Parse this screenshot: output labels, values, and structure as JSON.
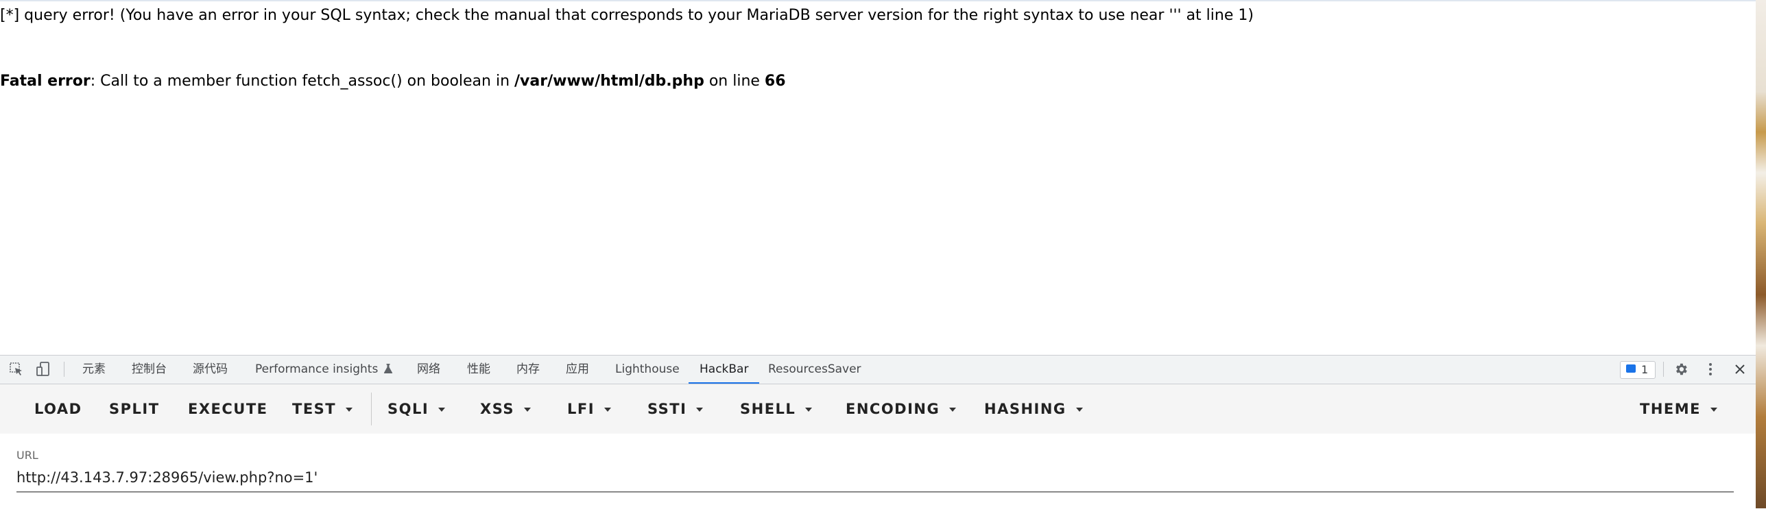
{
  "page": {
    "query_error": "[*] query error! (You have an error in your SQL syntax; check the manual that corresponds to your MariaDB server version for the right syntax to use near ''' at line 1)",
    "fatal_label": "Fatal error",
    "fatal_mid": ": Call to a member function fetch_assoc() on boolean in ",
    "fatal_path": "/var/www/html/db.php",
    "fatal_online": " on line ",
    "fatal_line": "66"
  },
  "devtools": {
    "tabs": [
      "元素",
      "控制台",
      "源代码",
      "Performance insights",
      "网络",
      "性能",
      "内存",
      "应用",
      "Lighthouse",
      "HackBar",
      "ResourcesSaver"
    ],
    "active_tab": "HackBar",
    "issues_count": "1",
    "icons": [
      "inspect-element-icon",
      "device-toolbar-icon",
      "flask-icon",
      "issues-icon",
      "gear-icon",
      "more-vertical-icon",
      "close-icon"
    ]
  },
  "hackbar": {
    "buttons": {
      "load": "LOAD",
      "split": "SPLIT",
      "execute": "EXECUTE",
      "test": "TEST",
      "sqli": "SQLI",
      "xss": "XSS",
      "lfi": "LFI",
      "ssti": "SSTI",
      "shell": "SHELL",
      "encoding": "ENCODING",
      "hashing": "HASHING",
      "theme": "THEME"
    },
    "url_label": "URL",
    "url_value": "http://43.143.7.97:28965/view.php?no=1'"
  },
  "colors": {
    "active_tab_underline": "#1a73e8",
    "toolbar_bg": "#f5f5f5",
    "tabbar_bg": "#f1f3f4"
  }
}
